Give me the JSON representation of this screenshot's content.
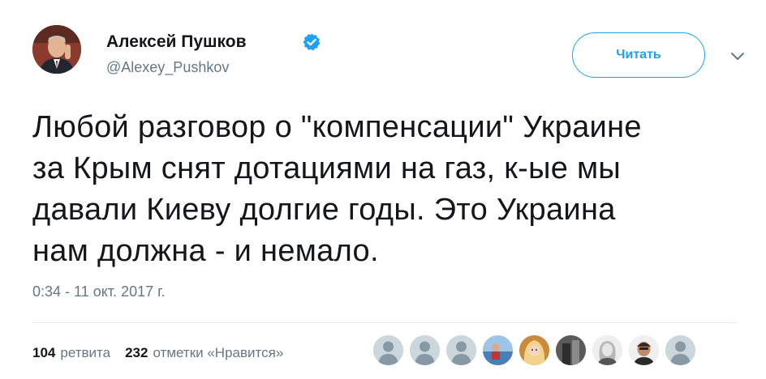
{
  "author": {
    "name": "Алексей Пушков",
    "handle": "@Alexey_Pushkov",
    "verified": true
  },
  "follow_button": {
    "label": "Читать"
  },
  "menu_icon": "chevron-down-icon",
  "tweet": {
    "lines": [
      "Любой разговор о \"компенсации\" Украине",
      "за Крым снят дотациями на газ, к-ые мы",
      "давали Киеву долгие годы. Это Украина",
      "нам должна - и немало."
    ]
  },
  "timestamp": "0:34 - 11 окт. 2017 г.",
  "stats": {
    "retweets_count": "104",
    "retweets_label": "ретвита",
    "likes_count": "232",
    "likes_label": "отметки «Нравится»"
  },
  "likers": [
    "default-avatar",
    "default-avatar",
    "default-avatar",
    "photo-avatar",
    "photo-avatar",
    "photo-avatar",
    "photo-avatar",
    "photo-avatar",
    "default-avatar"
  ],
  "colors": {
    "accent": "#1da1f2",
    "text": "#14171a",
    "secondary": "#657786",
    "divider": "#e6ecf0"
  }
}
